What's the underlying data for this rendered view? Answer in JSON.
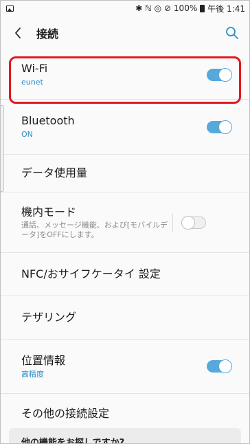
{
  "status_bar": {
    "glyphs": "✱ ℕ ◎ ⊘",
    "battery_percent": "100%",
    "time": "午後 1:41"
  },
  "header": {
    "title": "接続"
  },
  "settings": [
    {
      "title": "Wi-Fi",
      "subtitle": "eunet",
      "toggle": "on"
    },
    {
      "title": "Bluetooth",
      "subtitle": "ON",
      "toggle": "on"
    },
    {
      "title": "データ使用量"
    },
    {
      "title": "機内モード",
      "subtitle": "通話、メッセージ機能、および[モバイルデータ]をOFFにします。",
      "toggle": "off"
    },
    {
      "title": "NFC/おサイフケータイ 設定"
    },
    {
      "title": "テザリング"
    },
    {
      "title": "位置情報",
      "subtitle": "高精度",
      "toggle": "on"
    },
    {
      "title": "その他の接続設定"
    }
  ],
  "suggestion_card": {
    "title": "他の機能をお探しですか?"
  },
  "colors": {
    "accent_blue": "#57a9dc",
    "subtitle_blue": "#2a8ec8",
    "highlight_red": "#e0191e"
  },
  "icons": {
    "back": "chevron-left-icon",
    "search": "search-icon"
  }
}
